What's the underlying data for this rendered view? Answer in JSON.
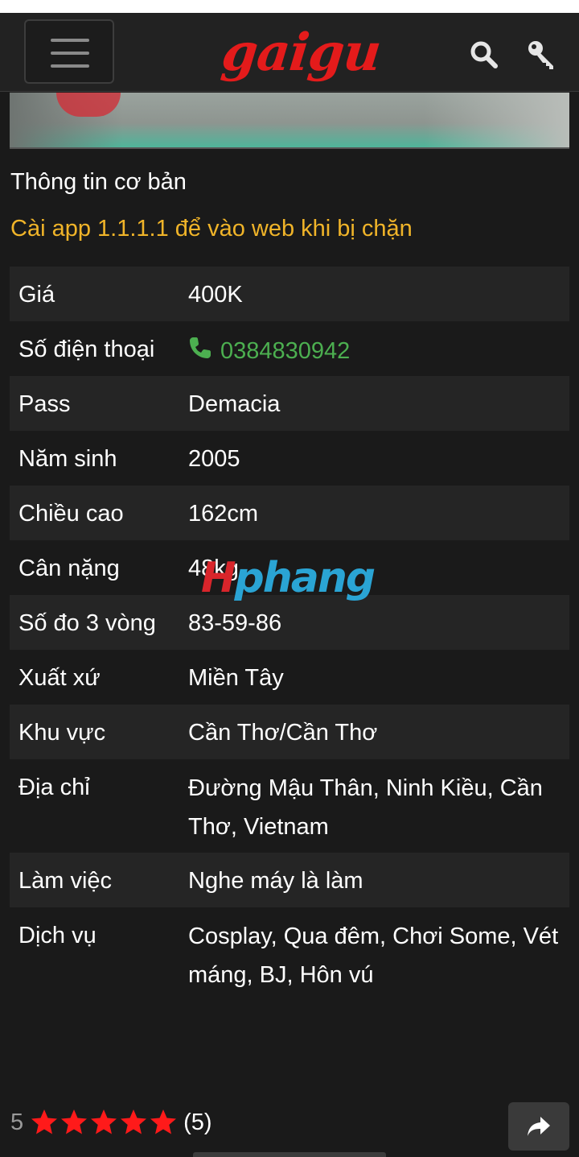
{
  "header": {
    "logo_text": "gaigu",
    "menu_icon": "hamburger-menu-icon",
    "search_icon": "search-icon",
    "login_icon": "key-icon"
  },
  "section_title": "Thông tin cơ bản",
  "notice": "Cài app 1.1.1.1 để vào web khi bị chặn",
  "info": {
    "gia": {
      "label": "Giá",
      "value": "400K"
    },
    "phone": {
      "label": "Số điện thoại",
      "value": "0384830942"
    },
    "pass": {
      "label": "Pass",
      "value": "Demacia"
    },
    "nam_sinh": {
      "label": "Năm sinh",
      "value": "2005"
    },
    "chieu_cao": {
      "label": "Chiều cao",
      "value": "162cm"
    },
    "can_nang": {
      "label": "Cân nặng",
      "value": "48kg"
    },
    "so_do": {
      "label": "Số đo 3 vòng",
      "value": "83-59-86"
    },
    "xuat_xu": {
      "label": "Xuất xứ",
      "value": "Miền Tây"
    },
    "khu_vuc": {
      "label": "Khu vực",
      "value": "Cần Thơ/Cần Thơ"
    },
    "dia_chi": {
      "label": "Địa chỉ",
      "value": "Đường Mậu Thân, Ninh Kiều, Cần Thơ, Vietnam"
    },
    "lam_viec": {
      "label": "Làm việc",
      "value": "Nghe máy là làm"
    },
    "dich_vu": {
      "label": "Dịch vụ",
      "value": "Cosplay, Qua đêm, Chơi Some, Vét máng, BJ, Hôn vú"
    }
  },
  "watermark": {
    "part_a": "H",
    "part_b": "phang"
  },
  "rating": {
    "score": "5",
    "stars": 5,
    "count": "(5)"
  },
  "share_icon": "share-arrow-icon",
  "colors": {
    "background": "#1a1a1a",
    "logo": "#e41b1b",
    "notice": "#f0b429",
    "phone": "#4caf50",
    "star": "#ff1a1a"
  }
}
